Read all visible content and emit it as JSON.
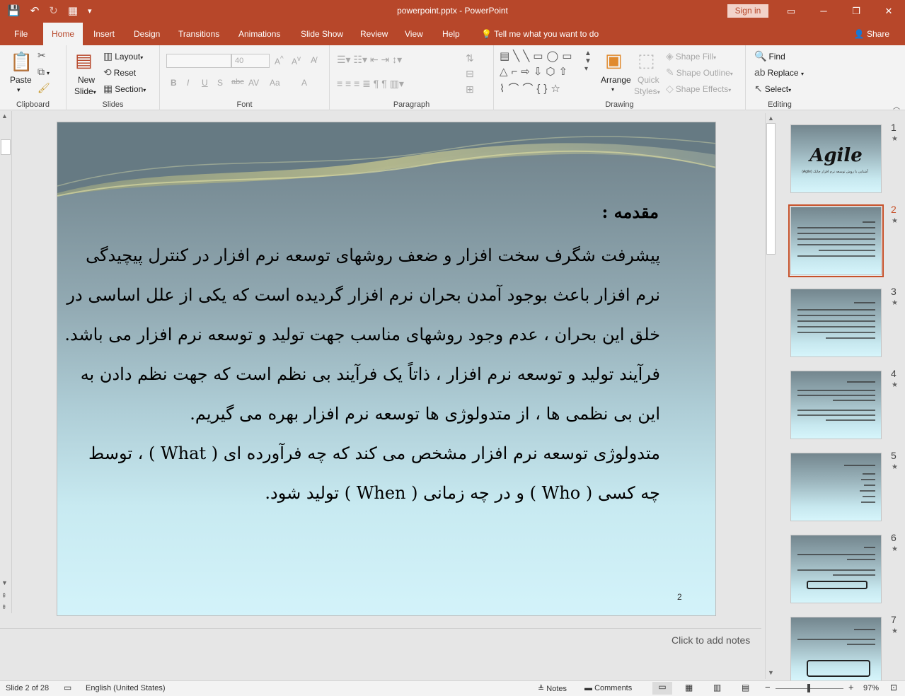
{
  "window": {
    "title": "powerpoint.pptx  -  PowerPoint",
    "signin": "Sign in"
  },
  "qat": {
    "save": "💾",
    "undo": "↶",
    "redo": "↻",
    "present": "▦",
    "more": "▾"
  },
  "tabs": [
    {
      "label": "File"
    },
    {
      "label": "Home"
    },
    {
      "label": "Insert"
    },
    {
      "label": "Design"
    },
    {
      "label": "Transitions"
    },
    {
      "label": "Animations"
    },
    {
      "label": "Slide Show"
    },
    {
      "label": "Review"
    },
    {
      "label": "View"
    },
    {
      "label": "Help"
    }
  ],
  "tellme": "Tell me what you want to do",
  "share": "Share",
  "ribbon": {
    "clipboard": {
      "label": "Clipboard",
      "paste": "Paste"
    },
    "slides": {
      "label": "Slides",
      "new_slide_1": "New",
      "new_slide_2": "Slide",
      "layout": "Layout",
      "reset": "Reset",
      "section": "Section"
    },
    "font": {
      "label": "Font",
      "font_name": "",
      "font_size": "40",
      "bold": "B",
      "italic": "I",
      "underline": "U",
      "shadow": "S",
      "strike": "abc",
      "spacing": "AV",
      "case": "Aa",
      "color": "A"
    },
    "paragraph": {
      "label": "Paragraph"
    },
    "drawing": {
      "label": "Drawing",
      "arrange": "Arrange",
      "quick_styles_1": "Quick",
      "quick_styles_2": "Styles",
      "shape_fill": "Shape Fill",
      "shape_outline": "Shape Outline",
      "shape_effects": "Shape Effects"
    },
    "editing": {
      "label": "Editing",
      "find": "Find",
      "replace": "Replace",
      "select": "Select"
    }
  },
  "slide": {
    "heading": "مقدمه :",
    "lines": [
      "پیشرفت شگرف سخت افزار و ضعف روشهای توسعه نرم افزار در کنترل پیچیدگی",
      "نرم افزار باعث بوجود آمدن بحران نرم افزار گردیده است که یکی از علل اساسی در",
      "خلق این بحران ، عدم وجود روشهای مناسب جهت تولید و توسعه نرم افزار می باشد.",
      "فرآیند تولید و توسعه نرم افزار ، ذاتاً یک فرآیند بی نظم است که جهت نظم دادن به",
      "این بی نظمی ها ، از متدولوژی ها توسعه نرم افزار بهره می گیریم.",
      "متدولوژی توسعه نرم افزار مشخص می کند که چه فرآورده ای ( What ) ، توسط",
      "چه کسی ( Who ) و در چه زمانی ( When ) تولید شود."
    ],
    "number": "2"
  },
  "notes_placeholder": "Click to add notes",
  "thumbnails": [
    {
      "num": "1",
      "title": "Agile",
      "sub": "آشنایی با روش توسعه نرم افزار چابک (Agile)"
    },
    {
      "num": "2"
    },
    {
      "num": "3"
    },
    {
      "num": "4"
    },
    {
      "num": "5"
    },
    {
      "num": "6"
    },
    {
      "num": "7"
    }
  ],
  "status": {
    "slide": "Slide 2 of 28",
    "language": "English (United States)",
    "notes": "Notes",
    "comments": "Comments",
    "zoom": "97%"
  }
}
